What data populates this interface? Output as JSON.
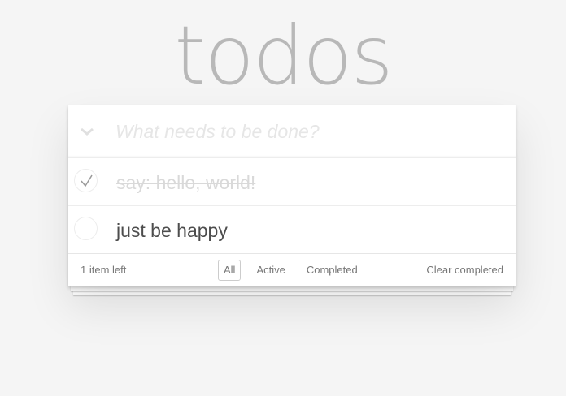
{
  "title": "todos",
  "new_todo": {
    "placeholder": "What needs to be done?",
    "value": ""
  },
  "todos": [
    {
      "text": "say: hello, world!",
      "completed": true
    },
    {
      "text": "just be happy",
      "completed": false
    }
  ],
  "footer": {
    "count": "1 item left",
    "filters": [
      {
        "label": "All",
        "selected": true
      },
      {
        "label": "Active",
        "selected": false
      },
      {
        "label": "Completed",
        "selected": false
      }
    ],
    "clear": "Clear completed"
  }
}
